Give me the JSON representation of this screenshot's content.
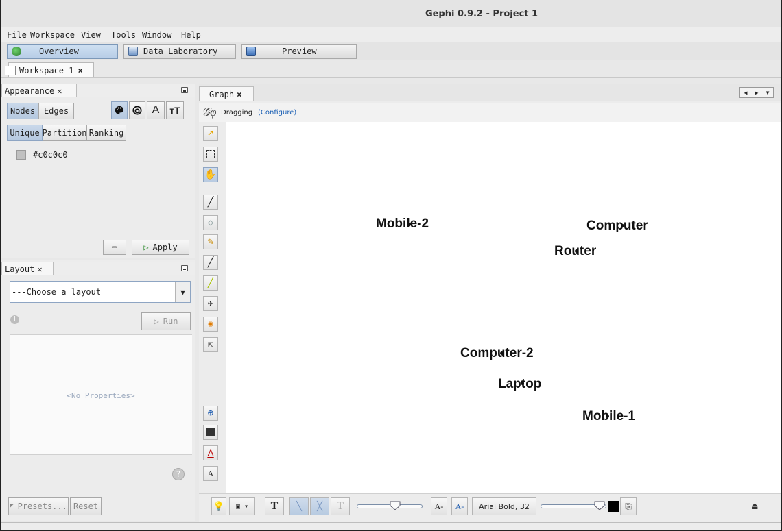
{
  "window": {
    "title": "Gephi 0.9.2 - Project 1"
  },
  "menu": [
    "File",
    "Workspace",
    "View",
    "Tools",
    "Window",
    "Help"
  ],
  "perspectives": [
    {
      "label": "Overview",
      "active": true
    },
    {
      "label": "Data Laboratory",
      "active": false
    },
    {
      "label": "Preview",
      "active": false
    }
  ],
  "workspace_tab": {
    "label": "Workspace 1",
    "close": "×"
  },
  "appearance": {
    "tab": "Appearance",
    "close": "✕",
    "element_tabs": [
      "Nodes",
      "Edges"
    ],
    "mode_tabs": [
      "Unique",
      "Partition",
      "Ranking"
    ],
    "color_value": "#c0c0c0",
    "apply_label": "Apply"
  },
  "layout": {
    "tab": "Layout",
    "close": "✕",
    "choose_placeholder": "---Choose a layout",
    "run_label": "Run",
    "no_properties": "<No Properties>",
    "presets_label": "Presets...",
    "reset_label": "Reset"
  },
  "graph": {
    "tab": "Graph",
    "close": "×",
    "status_mode": "Dragging",
    "status_configure": "(Configure)",
    "nodes": [
      {
        "label": "Mobile-2"
      },
      {
        "label": "Computer"
      },
      {
        "label": "Router"
      },
      {
        "label": "Computer-2"
      },
      {
        "label": "Laptop"
      },
      {
        "label": "Mobile-1"
      }
    ]
  },
  "bottom_toolbar": {
    "font_label": "Arial Bold, 32",
    "font_decrease": "A-",
    "font_increase": "A-"
  },
  "colors": {
    "node_color": "#c0c0c0",
    "accent": "#b5c8df",
    "link": "#1a5fb4"
  }
}
